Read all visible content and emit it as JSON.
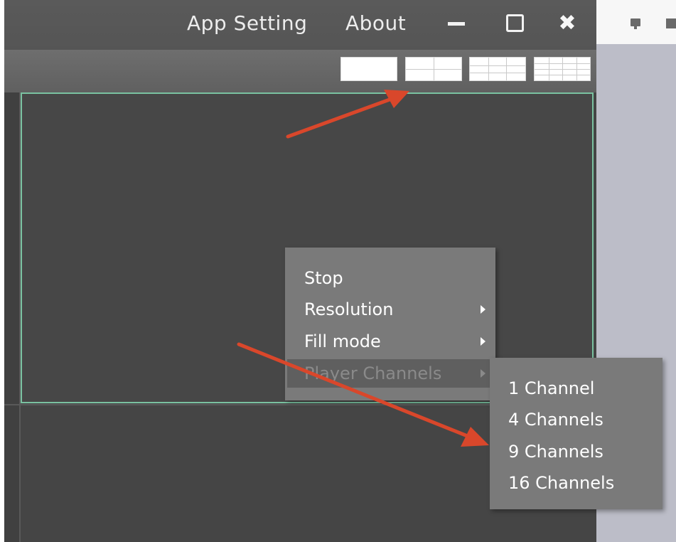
{
  "titlebar": {
    "menu": [
      {
        "label": "App Setting"
      },
      {
        "label": "About"
      }
    ],
    "controls": {
      "minimize_icon": "minimize-icon",
      "maximize_icon": "maximize-icon",
      "close_glyph": "✖"
    }
  },
  "toolbar": {
    "layout_buttons": [
      {
        "icon": "layout-1-icon",
        "grid": "1x1"
      },
      {
        "icon": "layout-4-icon",
        "grid": "2x2"
      },
      {
        "icon": "layout-9-icon",
        "grid": "3x3"
      },
      {
        "icon": "layout-16-icon",
        "grid": "4x4"
      }
    ]
  },
  "context_menu": {
    "items": [
      {
        "label": "Stop",
        "has_submenu": false
      },
      {
        "label": "Resolution",
        "has_submenu": true
      },
      {
        "label": "Fill mode",
        "has_submenu": true
      },
      {
        "label": "Player Channels",
        "has_submenu": true,
        "highlighted": true
      }
    ]
  },
  "submenu": {
    "items": [
      {
        "label": "1 Channel"
      },
      {
        "label": "4 Channels"
      },
      {
        "label": "9 Channels"
      },
      {
        "label": "16 Channels"
      }
    ]
  },
  "side_panel": {
    "icons": [
      "monitor-icon",
      "square-icon"
    ]
  },
  "colors": {
    "accent_border": "#7ac2a1",
    "annotation_arrow": "#d9472b",
    "window_bg": "#454545",
    "menu_bg": "#7a7a7a"
  }
}
